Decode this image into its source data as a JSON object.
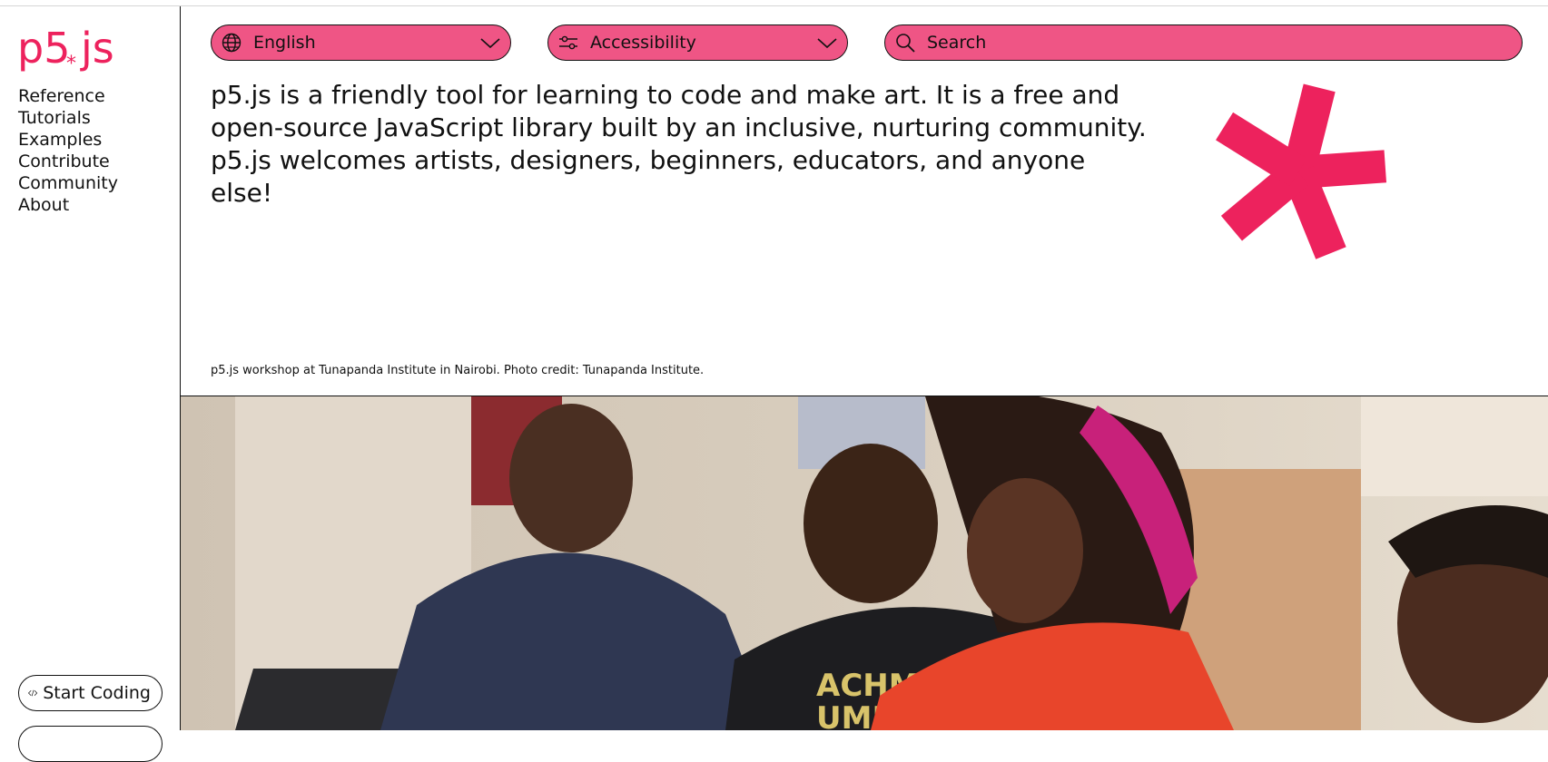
{
  "brand": {
    "logo_text": "p5.js",
    "accent_color": "#ed225d",
    "control_color": "#ef5585"
  },
  "sidebar": {
    "nav": [
      {
        "label": "Reference"
      },
      {
        "label": "Tutorials"
      },
      {
        "label": "Examples"
      },
      {
        "label": "Contribute"
      },
      {
        "label": "Community"
      },
      {
        "label": "About"
      }
    ],
    "start_coding_label": "Start Coding",
    "start_coding_icon": "code-brackets-icon"
  },
  "controls": {
    "language": {
      "value": "English",
      "icon": "globe-icon"
    },
    "accessibility": {
      "label": "Accessibility",
      "icon": "sliders-icon"
    },
    "search": {
      "placeholder": "Search",
      "icon": "search-icon"
    }
  },
  "hero": {
    "intro": "p5.js is a friendly tool for learning to code and make art. It is a free and open-source JavaScript library built by an inclusive, nurturing community. p5.js welcomes artists, designers, beginners, educators, and anyone else!",
    "decoration": "asterisk-icon",
    "caption": "p5.js workshop at Tunapanda Institute in Nairobi. Photo credit: Tunapanda Institute."
  }
}
